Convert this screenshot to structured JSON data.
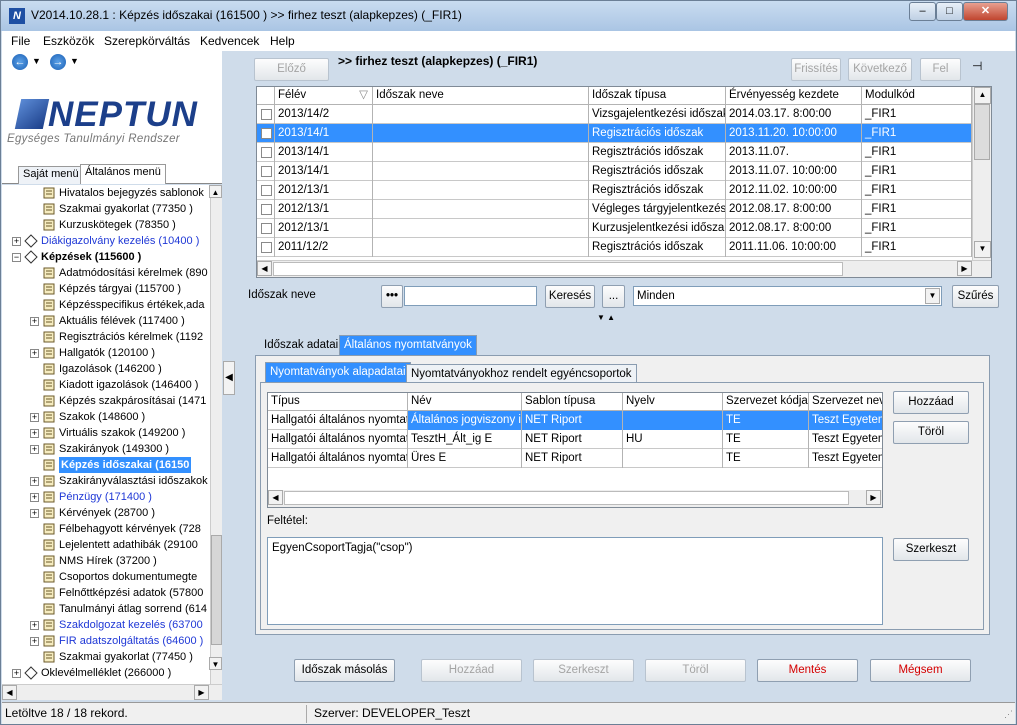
{
  "window": {
    "title": "V2014.10.28.1 : Képzés időszakai (161500  ) >> firhez teszt (alapkepzes) (_FIR1)",
    "controls": [
      "–",
      "□",
      "✕"
    ]
  },
  "menu": [
    "File",
    "Eszközök",
    "Szerepkörváltás",
    "Kedvencek",
    "Help"
  ],
  "logo": {
    "word": "NEPTUN",
    "subtitle": "Egységes Tanulmányi Rendszer"
  },
  "sidebar": {
    "tabs": [
      "Saját menü",
      "Általános menü"
    ],
    "tree": [
      {
        "label": "Hivatalos bejegyzés sablonok",
        "level": 3,
        "style": ""
      },
      {
        "label": "Szakmai gyakorlat (77350  )",
        "level": 3,
        "style": ""
      },
      {
        "label": "Kurzuskötegek (78350  )",
        "level": 3,
        "style": ""
      },
      {
        "label": "Diákigazolvány kezelés (10400  )",
        "level": 1,
        "style": "blue",
        "exp": "+"
      },
      {
        "label": "Képzések (115600  )",
        "level": 1,
        "style": "bold",
        "exp": "−"
      },
      {
        "label": "Adatmódosítási kérelmek (890",
        "level": 2,
        "style": ""
      },
      {
        "label": "Képzés tárgyai (115700  )",
        "level": 2,
        "style": ""
      },
      {
        "label": "Képzésspecifikus értékek,ada",
        "level": 2,
        "style": ""
      },
      {
        "label": "Aktuális félévek (117400  )",
        "level": 2,
        "style": "",
        "exp": "+"
      },
      {
        "label": "Regisztrációs kérelmek (1192",
        "level": 2,
        "style": ""
      },
      {
        "label": "Hallgatók (120100  )",
        "level": 2,
        "style": "",
        "exp": "+"
      },
      {
        "label": "Igazolások (146200  )",
        "level": 2,
        "style": ""
      },
      {
        "label": "Kiadott igazolások (146400  )",
        "level": 2,
        "style": ""
      },
      {
        "label": "Képzés szakpárosításai (1471",
        "level": 2,
        "style": ""
      },
      {
        "label": "Szakok (148600  )",
        "level": 2,
        "style": "",
        "exp": "+"
      },
      {
        "label": "Virtuális szakok (149200  )",
        "level": 2,
        "style": "",
        "exp": "+"
      },
      {
        "label": "Szakirányok (149300  )",
        "level": 2,
        "style": "",
        "exp": "+"
      },
      {
        "label": "Képzés időszakai (16150",
        "level": 2,
        "style": "sel"
      },
      {
        "label": "Szakirányválasztási időszakok",
        "level": 2,
        "style": "",
        "exp": "+"
      },
      {
        "label": "Pénzügy (171400  )",
        "level": 2,
        "style": "blue",
        "exp": "+"
      },
      {
        "label": "Kérvények (28700  )",
        "level": 2,
        "style": "",
        "exp": "+"
      },
      {
        "label": "Félbehagyott kérvények (728",
        "level": 2,
        "style": ""
      },
      {
        "label": "Lejelentett adathibák (29100",
        "level": 2,
        "style": ""
      },
      {
        "label": "NMS Hírek (37200  )",
        "level": 2,
        "style": ""
      },
      {
        "label": "Csoportos dokumentumegte",
        "level": 2,
        "style": ""
      },
      {
        "label": "Felnőttképzési adatok (57800",
        "level": 2,
        "style": ""
      },
      {
        "label": "Tanulmányi átlag sorrend (614",
        "level": 2,
        "style": ""
      },
      {
        "label": "Szakdolgozat kezelés (63700",
        "level": 2,
        "style": "blue",
        "exp": "+"
      },
      {
        "label": "FIR adatszolgáltatás (64600  )",
        "level": 2,
        "style": "blue",
        "exp": "+"
      },
      {
        "label": "Szakmai gyakorlat (77450  )",
        "level": 2,
        "style": ""
      },
      {
        "label": "Oklevélmelléklet (266000  )",
        "level": 1,
        "style": "",
        "exp": "+"
      }
    ]
  },
  "toolbar": {
    "prev": "Előző",
    "page_title": ">> firhez teszt (alapkepzes) (_FIR1)",
    "refresh": "Frissítés",
    "next": "Következő",
    "up": "Fel"
  },
  "periods_table": {
    "columns": [
      "Félév",
      "Időszak neve",
      "Időszak típusa",
      "Érvényesség kezdete",
      "Modulkód"
    ],
    "rows": [
      [
        "2013/14/2",
        "",
        "Vizsgajelentkezési időszak",
        "2014.03.17. 8:00:00",
        "_FIR1"
      ],
      [
        "2013/14/1",
        "",
        "Regisztrációs időszak",
        "2013.11.20. 10:00:00",
        "_FIR1"
      ],
      [
        "2013/14/1",
        "",
        "Regisztrációs időszak",
        "2013.11.07.",
        "_FIR1"
      ],
      [
        "2013/14/1",
        "",
        "Regisztrációs időszak",
        "2013.11.07. 10:00:00",
        "_FIR1"
      ],
      [
        "2012/13/1",
        "",
        "Regisztrációs időszak",
        "2012.11.02. 10:00:00",
        "_FIR1"
      ],
      [
        "2012/13/1",
        "",
        "Végleges tárgyjelentkezés",
        "2012.08.17. 8:00:00",
        "_FIR1"
      ],
      [
        "2012/13/1",
        "",
        "Kurzusjelentkezési időszak",
        "2012.08.17. 8:00:00",
        "_FIR1"
      ],
      [
        "2011/12/2",
        "",
        "Regisztrációs időszak",
        "2011.11.06. 10:00:00",
        "_FIR1"
      ]
    ],
    "selected_row": 1
  },
  "search": {
    "label": "Időszak neve",
    "dots": "•••",
    "value": "",
    "search_btn": "Keresés",
    "ellipsis_btn": "...",
    "filter_value": "Minden",
    "filter_btn": "Szűrés"
  },
  "detail_tabs": [
    "Időszak adatai",
    "Általános nyomtatványok"
  ],
  "sub_tabs": [
    "Nyomtatványok alapadatai",
    "Nyomtatványokhoz rendelt egyéncsoportok"
  ],
  "forms_table": {
    "columns": [
      "Típus",
      "Név",
      "Sablon típusa",
      "Nyelv",
      "Szervezet kódja",
      "Szervezet neve"
    ],
    "rows": [
      [
        "Hallgatói általános nyomtatvá",
        "Általános jogviszony iga",
        "NET Riport",
        "",
        "TE",
        "Teszt Egyetem"
      ],
      [
        "Hallgatói általános nyomtatvá",
        "TesztH_Ált_ig E",
        "NET Riport",
        "HU",
        "TE",
        "Teszt Egyetem"
      ],
      [
        "Hallgatói általános nyomtatvá",
        "Üres E",
        "NET Riport",
        "",
        "TE",
        "Teszt Egyetem"
      ]
    ],
    "selected_row": 0
  },
  "forms_buttons": {
    "add": "Hozzáad",
    "delete": "Töröl",
    "edit": "Szerkeszt"
  },
  "condition": {
    "label": "Feltétel:",
    "value": "EgyenCsoportTagja(\"csop\")"
  },
  "bottom_buttons": {
    "copy": "Időszak másolás",
    "add": "Hozzáad",
    "edit": "Szerkeszt",
    "delete": "Töröl",
    "save": "Mentés",
    "cancel": "Mégsem"
  },
  "status": {
    "records": "Letöltve 18 / 18 rekord.",
    "server": "Szerver: DEVELOPER_Teszt"
  },
  "colors": {
    "selection": "#3390ff",
    "link": "#1f38d6",
    "danger": "#d40000",
    "brand": "#1c3f8a"
  }
}
